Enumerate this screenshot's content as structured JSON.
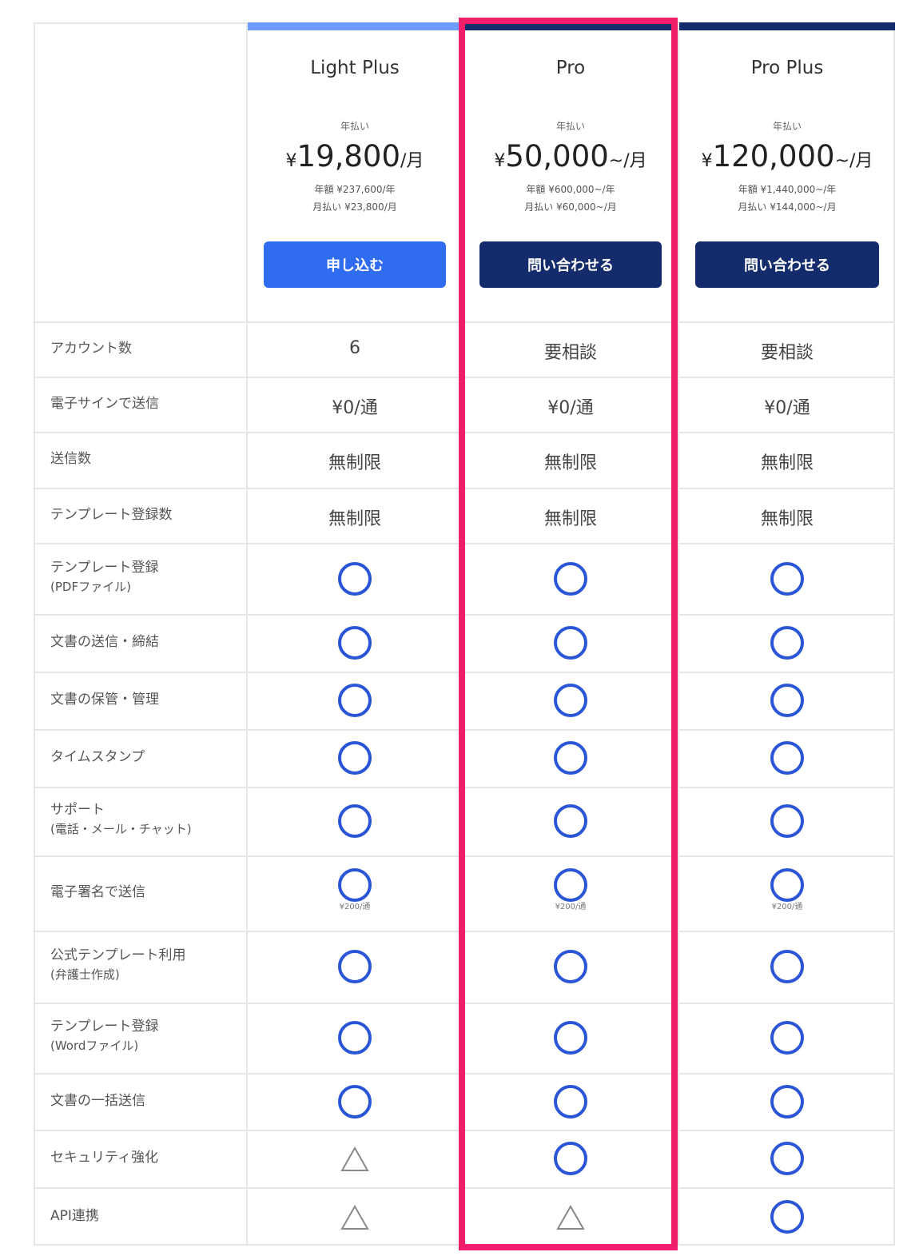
{
  "plans": [
    {
      "name": "Light Plus",
      "billing_label": "年払い",
      "price_yen": "¥",
      "price_amount": "19,800",
      "price_unit": "/月",
      "annual": "年額 ¥237,600/年",
      "monthly": "月払い ¥23,800/月",
      "cta": "申し込む",
      "accent": "#6d9bff",
      "button_color": "#2f6cf0"
    },
    {
      "name": "Pro",
      "billing_label": "年払い",
      "price_yen": "¥",
      "price_amount": "50,000",
      "price_unit": "~/月",
      "annual": "年額 ¥600,000~/年",
      "monthly": "月払い ¥60,000~/月",
      "cta": "問い合わせる",
      "accent": "#152c6c",
      "button_color": "#152c6c"
    },
    {
      "name": "Pro Plus",
      "billing_label": "年払い",
      "price_yen": "¥",
      "price_amount": "120,000",
      "price_unit": "~/月",
      "annual": "年額 ¥1,440,000~/年",
      "monthly": "月払い ¥144,000~/月",
      "cta": "問い合わせる",
      "accent": "#152c6c",
      "button_color": "#152c6c"
    }
  ],
  "features": [
    {
      "label": "アカウント数",
      "sub": "",
      "values": [
        "6",
        "要相談",
        "要相談"
      ]
    },
    {
      "label": "電子サインで送信",
      "sub": "",
      "values": [
        "¥0/通",
        "¥0/通",
        "¥0/通"
      ]
    },
    {
      "label": "送信数",
      "sub": "",
      "values": [
        "無制限",
        "無制限",
        "無制限"
      ]
    },
    {
      "label": "テンプレート登録数",
      "sub": "",
      "values": [
        "無制限",
        "無制限",
        "無制限"
      ]
    },
    {
      "label": "テンプレート登録",
      "sub": "(PDFファイル)",
      "values": [
        "circle",
        "circle",
        "circle"
      ]
    },
    {
      "label": "文書の送信・締結",
      "sub": "",
      "values": [
        "circle",
        "circle",
        "circle"
      ]
    },
    {
      "label": "文書の保管・管理",
      "sub": "",
      "values": [
        "circle",
        "circle",
        "circle"
      ]
    },
    {
      "label": "タイムスタンプ",
      "sub": "",
      "values": [
        "circle",
        "circle",
        "circle"
      ]
    },
    {
      "label": "サポート",
      "sub": "(電話・メール・チャット)",
      "values": [
        "circle",
        "circle",
        "circle"
      ]
    },
    {
      "label": "電子署名で送信",
      "sub": "",
      "values": [
        "circle",
        "circle",
        "circle"
      ],
      "note": "¥200/通"
    },
    {
      "label": "公式テンプレート利用",
      "sub": "(弁護士作成)",
      "values": [
        "circle",
        "circle",
        "circle"
      ]
    },
    {
      "label": "テンプレート登録",
      "sub": "(Wordファイル)",
      "values": [
        "circle",
        "circle",
        "circle"
      ]
    },
    {
      "label": "文書の一括送信",
      "sub": "",
      "values": [
        "circle",
        "circle",
        "circle"
      ]
    },
    {
      "label": "セキュリティ強化",
      "sub": "",
      "values": [
        "triangle",
        "circle",
        "circle"
      ]
    },
    {
      "label": "API連携",
      "sub": "",
      "values": [
        "triangle",
        "triangle",
        "circle"
      ]
    }
  ],
  "icons": {
    "available": "circle-icon",
    "partial": "triangle-icon"
  },
  "colors": {
    "circle": "#2a55d6",
    "triangle": "#888888",
    "highlight": "#f01e6a"
  }
}
